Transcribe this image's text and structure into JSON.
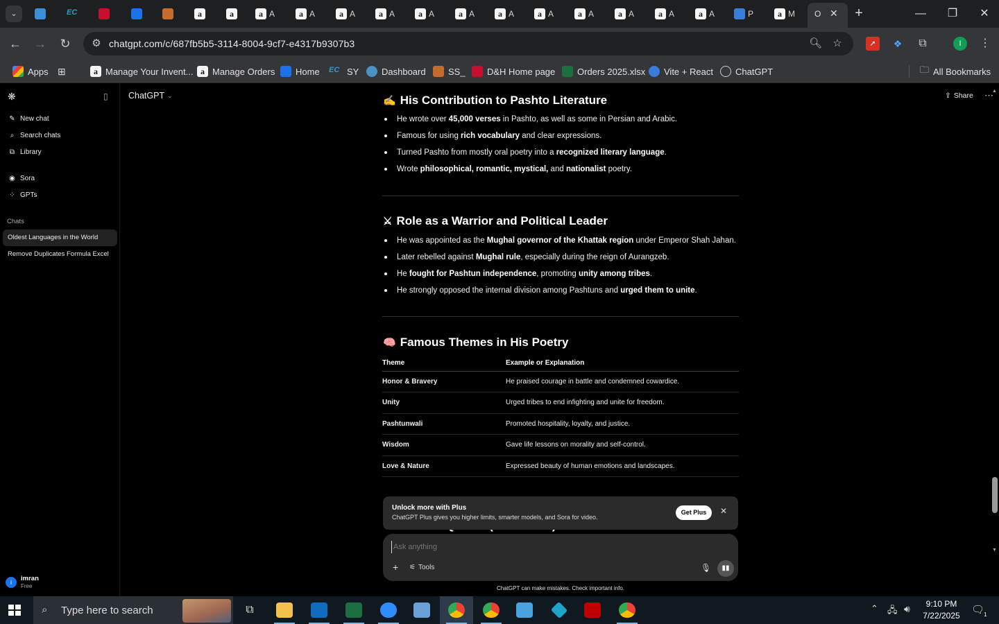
{
  "browser": {
    "url": "chatgpt.com/c/687fb5b5-3114-8004-9cf7-e4317b9307b3",
    "tabs": [
      {
        "label": "",
        "icon": "edge-blue-icon"
      },
      {
        "label": "",
        "icon": "ec-icon"
      },
      {
        "label": "",
        "icon": "dh-red-icon"
      },
      {
        "label": "",
        "icon": "docs-icon"
      },
      {
        "label": "",
        "icon": "stack-icon"
      },
      {
        "label": "",
        "icon": "amazon-icon"
      },
      {
        "label": "",
        "icon": "amazon-icon"
      },
      {
        "label": "A",
        "icon": "amazon-icon"
      },
      {
        "label": "A",
        "icon": "amazon-icon"
      },
      {
        "label": "A",
        "icon": "amazon-icon"
      },
      {
        "label": "A",
        "icon": "amazon-icon"
      },
      {
        "label": "A",
        "icon": "amazon-icon"
      },
      {
        "label": "A",
        "icon": "amazon-icon"
      },
      {
        "label": "A",
        "icon": "amazon-icon"
      },
      {
        "label": "A",
        "icon": "amazon-icon"
      },
      {
        "label": "A",
        "icon": "amazon-icon"
      },
      {
        "label": "A",
        "icon": "amazon-icon"
      },
      {
        "label": "A",
        "icon": "amazon-icon"
      },
      {
        "label": "A",
        "icon": "amazon-icon"
      },
      {
        "label": "P",
        "icon": "dollar-icon"
      },
      {
        "label": "M",
        "icon": "amazon-icon"
      },
      {
        "label": "O",
        "icon": "chatgpt-icon"
      }
    ],
    "bookmarks": [
      {
        "label": "Apps"
      },
      {
        "label": "Manage Your Invent..."
      },
      {
        "label": "Manage Orders"
      },
      {
        "label": "Home"
      },
      {
        "label": "SY"
      },
      {
        "label": "Dashboard"
      },
      {
        "label": "SS_"
      },
      {
        "label": "D&H Home page"
      },
      {
        "label": "Orders 2025.xlsx"
      },
      {
        "label": "Vite + React"
      },
      {
        "label": "ChatGPT"
      }
    ],
    "all_bookmarks": "All Bookmarks",
    "profile_initial": "I"
  },
  "sidebar": {
    "nav": [
      {
        "label": "New chat"
      },
      {
        "label": "Search chats"
      },
      {
        "label": "Library"
      },
      {
        "label": "Sora"
      },
      {
        "label": "GPTs"
      }
    ],
    "chats_heading": "Chats",
    "chats": [
      {
        "label": "Oldest Languages in the World",
        "active": true
      },
      {
        "label": "Remove Duplicates Formula Excel",
        "active": false
      }
    ],
    "user": {
      "name": "imran",
      "plan": "Free",
      "initial": "i"
    }
  },
  "header": {
    "model": "ChatGPT",
    "share": "Share"
  },
  "content": {
    "section1": {
      "emoji": "✍",
      "title": "His Contribution to Pashto Literature",
      "points": [
        [
          "He wrote over ",
          "45,000 verses",
          " in Pashto, as well as some in Persian and Arabic."
        ],
        [
          "Famous for using ",
          "rich vocabulary",
          " and clear expressions."
        ],
        [
          "Turned Pashto from mostly oral poetry into a ",
          "recognized literary language",
          "."
        ],
        [
          "Wrote ",
          "philosophical, romantic, mystical,",
          " and ",
          "nationalist",
          " poetry."
        ]
      ]
    },
    "section2": {
      "emoji": "⚔",
      "title": "Role as a Warrior and Political Leader",
      "points": [
        [
          "He was appointed as the ",
          "Mughal governor of the Khattak region",
          " under Emperor Shah Jahan."
        ],
        [
          "Later rebelled against ",
          "Mughal rule",
          ", especially during the reign of Aurangzeb."
        ],
        [
          "He ",
          "fought for Pashtun independence",
          ", promoting ",
          "unity among tribes",
          "."
        ],
        [
          "He strongly opposed the internal division among Pashtuns and ",
          "urged them to unite",
          "."
        ]
      ]
    },
    "section3": {
      "emoji": "🧠",
      "title": "Famous Themes in His Poetry",
      "table": {
        "headers": [
          "Theme",
          "Example or Explanation"
        ],
        "rows": [
          [
            "Honor & Bravery",
            "He praised courage in battle and condemned cowardice."
          ],
          [
            "Unity",
            "Urged tribes to end infighting and unite for freedom."
          ],
          [
            "Pashtunwali",
            "Promoted hospitality, loyalty, and justice."
          ],
          [
            "Wisdom",
            "Gave life lessons on morality and self-control."
          ],
          [
            "Love & Nature",
            "Expressed beauty of human emotions and landscapes."
          ]
        ]
      }
    },
    "next_section_peek": "Famous Quotes (Translated)"
  },
  "banner": {
    "title": "Unlock more with Plus",
    "text": "ChatGPT Plus gives you higher limits, smarter models, and Sora for video.",
    "button": "Get Plus"
  },
  "composer": {
    "placeholder": "Ask anything",
    "tools": "Tools"
  },
  "footnote": "ChatGPT can make mistakes. Check important info.",
  "taskbar": {
    "search_placeholder": "Type here to search",
    "time": "9:10 PM",
    "date": "7/22/2025",
    "notifications": "1"
  },
  "colors": {
    "chrome_dark": "#1e1f20",
    "chrome_toolbar": "#35363a",
    "app_bg": "#000000",
    "composer_bg": "#2b2b2b",
    "taskbar_bg": "#101820",
    "accent_blue": "#1a73e8"
  }
}
